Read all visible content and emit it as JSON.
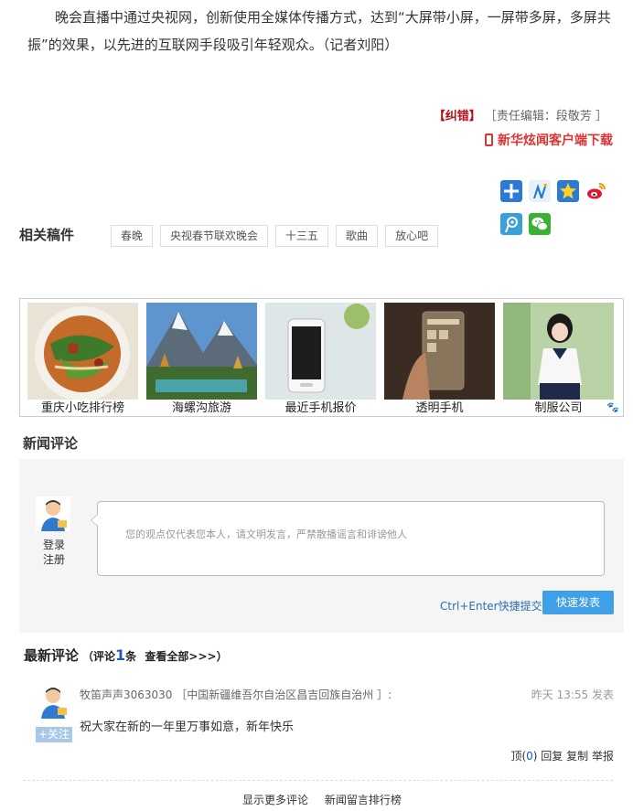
{
  "article": {
    "paragraph": "晚会直播中通过央视网，创新使用全媒体传播方式，达到“大屏带小屏，一屏带多屏，多屏共振”的效果，以先进的互联网手段吸引年轻观众。（记者刘阳）"
  },
  "correction": {
    "label": "【纠错】",
    "editor": "［责任编辑：段敬芳 ］"
  },
  "download": {
    "label": "新华炫闻客户端下载"
  },
  "share": {
    "icons": [
      "plus-share-icon",
      "n-share-icon",
      "star-share-icon",
      "weibo-icon",
      "tencent-weibo-icon",
      "wechat-icon"
    ]
  },
  "related": {
    "title": "相关稿件",
    "tags": [
      "春晚",
      "央视春节联欢晚会",
      "十三五",
      "歌曲",
      "放心吧"
    ]
  },
  "gallery": {
    "items": [
      {
        "caption": "重庆小吃排行榜",
        "icon": "noodle-photo"
      },
      {
        "caption": "海螺沟旅游",
        "icon": "mountain-photo"
      },
      {
        "caption": "最近手机报价",
        "icon": "phone-photo"
      },
      {
        "caption": "透明手机",
        "icon": "transparent-phone-photo"
      },
      {
        "caption": "制服公司",
        "icon": "uniform-photo"
      }
    ],
    "paw_icon": "paw-icon"
  },
  "comments": {
    "title": "新闻评论",
    "login": "登录",
    "register": "注册",
    "placeholder": "您的观点仅代表您本人，请文明发言，严禁散播谣言和诽谤他人",
    "hint": "Ctrl+Enter快捷提交",
    "submit": "快速发表"
  },
  "latest": {
    "title": "最新评论",
    "count_prefix": "（评论",
    "count": "1",
    "count_suffix": "条",
    "view_all": "查看全部>>>）",
    "items": [
      {
        "user": "牧笛声声3063030",
        "location": "［中国新疆维吾尔自治区昌吉回族自治州 ］:",
        "time": "昨天 13:55 发表",
        "follow": "+关注",
        "text": "祝大家在新的一年里万事如意，新年快乐",
        "up_label": "顶(",
        "up_count": "0",
        "up_close": ")",
        "reply": "回复",
        "copy": "复制",
        "report": "举报"
      }
    ]
  },
  "bottom": {
    "more": "显示更多评论",
    "ranking": "新闻留言排行榜"
  },
  "colors": {
    "accent": "#3fa0e8",
    "error": "#b0101a",
    "download": "#e03131",
    "link": "#1a5cbd"
  }
}
